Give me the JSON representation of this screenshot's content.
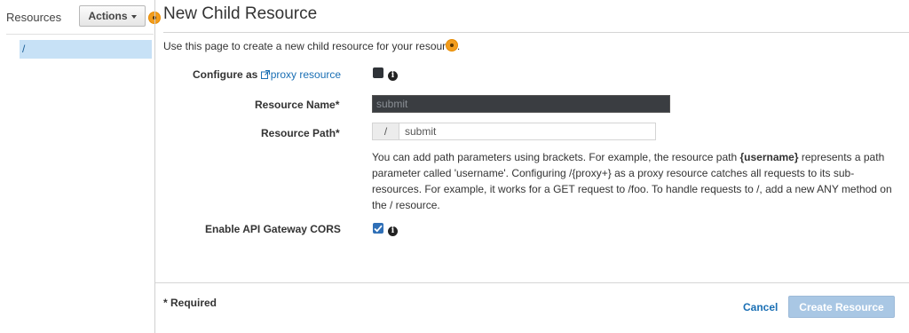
{
  "sidebar": {
    "title": "Resources",
    "actions_label": "Actions",
    "tree_items": [
      {
        "label": "/"
      }
    ]
  },
  "main": {
    "title": "New Child Resource",
    "intro": "Use this page to create a new child resource for your resource.",
    "configure_label": "Configure as",
    "proxy_link": "proxy resource",
    "proxy_checked": false,
    "resource_name_label": "Resource Name*",
    "resource_name_value": "submit",
    "resource_path_label": "Resource Path*",
    "resource_path_prefix": "/",
    "resource_path_value": "submit",
    "path_help": {
      "t1": "You can add path parameters using brackets. For example, the resource path ",
      "b1": "{username}",
      "t2": " represents a path parameter called 'username'. Configuring /{proxy+} as a proxy resource catches all requests to its sub-resources. For example, it works for a GET request to /foo. To handle requests to /, add a new ANY method on the / resource."
    },
    "cors_label": "Enable API Gateway CORS",
    "cors_checked": true,
    "required_note": "* Required",
    "cancel_label": "Cancel",
    "create_label": "Create Resource"
  },
  "icons": [
    "help-dot-icon",
    "external-link-icon",
    "info-icon",
    "checkmark-icon",
    "caret-down-icon"
  ],
  "colors": {
    "link": "#1a6fb4",
    "selected_tree_bg": "#c7e1f6",
    "help_dot": "#f29d1e",
    "create_button_bg": "#a9c7e4",
    "name_input_bg": "#3a3d41",
    "cors_checkbox": "#2f6fb7"
  }
}
